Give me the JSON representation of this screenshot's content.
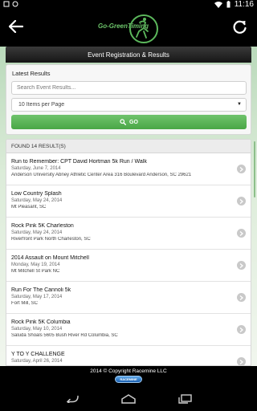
{
  "status_bar": {
    "time": "11:16"
  },
  "app_bar": {
    "logo_text": "Go-GreenTiming"
  },
  "section_header": "Event Registration & Results",
  "search": {
    "heading": "Latest Results",
    "placeholder": "Search Event Results...",
    "items_per_page": "10 Items per Page",
    "go_label": "GO"
  },
  "results": {
    "found_label": "FOUND 14 RESULT(S)",
    "items": [
      {
        "title": "Run to Remember: CPT David Hortman 5k Run / Walk",
        "date": "Saturday, June 7, 2014",
        "location": "Anderson University Abney Athletic Center Area 316 Boulevard Anderson, SC 29621"
      },
      {
        "title": "Low Country Splash",
        "date": "Saturday, May 24, 2014",
        "location": "Mt Pleasant, SC"
      },
      {
        "title": "Rock Pink 5K Charleston",
        "date": "Saturday, May 24, 2014",
        "location": "Riverfront Park North Charleston, SC"
      },
      {
        "title": "2014 Assault on Mount Mitchell",
        "date": "Monday, May 19, 2014",
        "location": "Mt Mitchell St Park NC"
      },
      {
        "title": "Run For The Cannoli 5k",
        "date": "Saturday, May 17, 2014",
        "location": "Fort Mill, SC"
      },
      {
        "title": "Rock Pink 5K Columbia",
        "date": "Saturday, May 10, 2014",
        "location": "Saluda Shoals 5605 Bush River Rd Columbia, SC"
      },
      {
        "title": "Y TO Y CHALLENGE",
        "date": "Saturday, April 26, 2014",
        "location": ""
      }
    ]
  },
  "footer": {
    "copyright": "2014 © Copyright Racemine LLC",
    "badge": "RACEMINE"
  },
  "colors": {
    "accent_green": "#4aa746",
    "bar_black": "#000000"
  },
  "icons": [
    "back-arrow-icon",
    "refresh-icon",
    "search-icon",
    "chevron-right-icon",
    "wifi-icon",
    "battery-icon",
    "nav-back-icon",
    "nav-home-icon",
    "nav-recents-icon"
  ]
}
